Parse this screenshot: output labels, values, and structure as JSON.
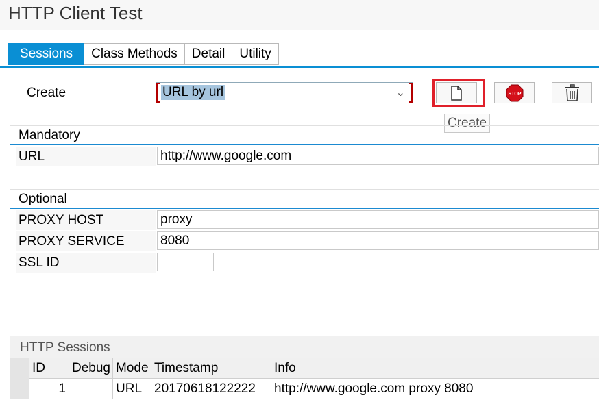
{
  "window": {
    "title": "HTTP Client Test"
  },
  "tabs": [
    {
      "label": "Sessions",
      "active": true
    },
    {
      "label": "Class Methods",
      "active": false
    },
    {
      "label": "Detail",
      "active": false
    },
    {
      "label": "Utility",
      "active": false
    }
  ],
  "create": {
    "label": "Create",
    "selected_value": "URL by url",
    "buttons": {
      "create_icon": "document-icon",
      "stop_icon": "stop-icon",
      "stop_text": "STOP",
      "delete_icon": "trash-icon"
    },
    "tooltip": "Create"
  },
  "mandatory": {
    "title": "Mandatory",
    "fields": [
      {
        "label": "URL",
        "value": "http://www.google.com"
      }
    ]
  },
  "optional": {
    "title": "Optional",
    "fields": [
      {
        "label": "PROXY HOST",
        "value": "proxy"
      },
      {
        "label": "PROXY SERVICE",
        "value": "8080"
      },
      {
        "label": "SSL ID",
        "value": ""
      }
    ]
  },
  "sessions": {
    "title": "HTTP Sessions",
    "columns": [
      "ID",
      "Debug",
      "Mode",
      "Timestamp",
      "Info"
    ],
    "rows": [
      {
        "id": "1",
        "debug": "",
        "mode": "URL",
        "timestamp": "20170618122222",
        "info": "http://www.google.com proxy 8080"
      }
    ]
  },
  "colors": {
    "accent": "#0a8fd4",
    "focus": "#e0202a",
    "stop": "#d4101a"
  }
}
